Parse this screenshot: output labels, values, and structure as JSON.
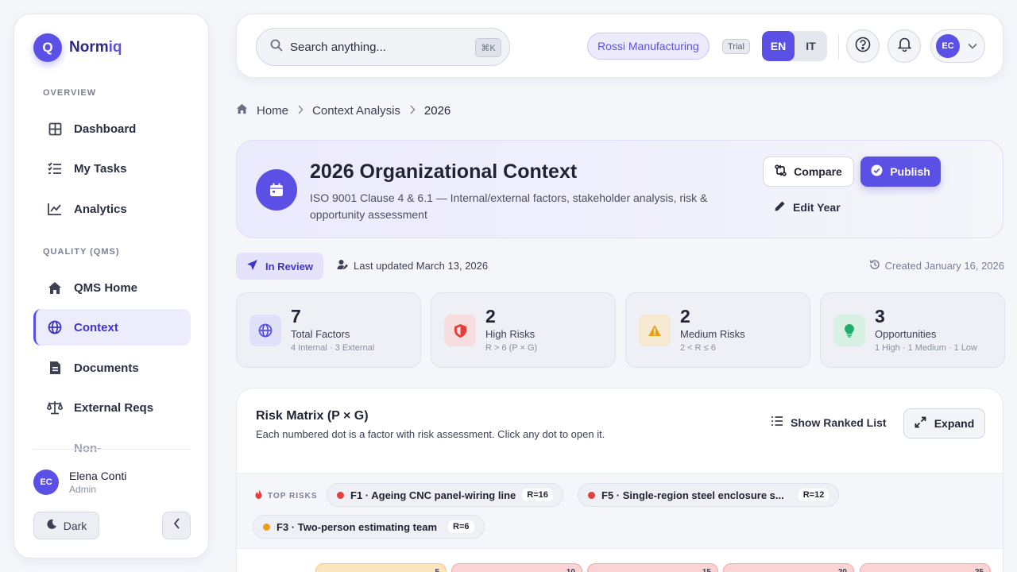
{
  "brand": {
    "name_prefix": "Norm",
    "name_suffix": "iq",
    "logo_letter": "Q"
  },
  "sidebar": {
    "sections": [
      {
        "label": "OVERVIEW"
      },
      {
        "label": "QUALITY (QMS)"
      }
    ],
    "items": [
      {
        "label": "Dashboard",
        "icon": "dashboard-grid-icon"
      },
      {
        "label": "My Tasks",
        "icon": "task-list-icon"
      },
      {
        "label": "Analytics",
        "icon": "line-chart-icon"
      },
      {
        "label": "QMS Home",
        "icon": "home-icon"
      },
      {
        "label": "Context",
        "icon": "globe-icon",
        "active": true
      },
      {
        "label": "Documents",
        "icon": "document-icon"
      },
      {
        "label": "External Reqs",
        "icon": "scale-icon"
      },
      {
        "label": "Non-",
        "icon": "none"
      }
    ],
    "user": {
      "initials": "EC",
      "name": "Elena Conti",
      "role": "Admin"
    },
    "theme_toggle": "Dark"
  },
  "topbar": {
    "search_placeholder": "Search anything...",
    "shortcut": "⌘K",
    "org": "Rossi Manufacturing",
    "plan": "Trial",
    "languages": [
      "EN",
      "IT"
    ],
    "active_language": "EN",
    "user_initials": "EC"
  },
  "breadcrumb": [
    "Home",
    "Context Analysis",
    "2026"
  ],
  "header": {
    "title": "2026 Organizational Context",
    "subtitle": "ISO 9001 Clause 4 & 6.1 — Internal/external factors, stakeholder analysis, risk & opportunity assessment",
    "compare": "Compare",
    "publish": "Publish",
    "edit": "Edit Year"
  },
  "status": {
    "state": "In Review",
    "updated": "Last updated March 13, 2026",
    "created": "Created January 16, 2026"
  },
  "stats": [
    {
      "value": "7",
      "label": "Total Factors",
      "sub": "4 Internal · 3 External",
      "color": "#5b50e6"
    },
    {
      "value": "2",
      "label": "High Risks",
      "sub": "R > 6 (P × G)",
      "color": "#e53e3e"
    },
    {
      "value": "2",
      "label": "Medium Risks",
      "sub": "2 < R ≤ 6",
      "color": "#e6a01a"
    },
    {
      "value": "3",
      "label": "Opportunities",
      "sub": "1 High · 1 Medium · 1 Low",
      "color": "#1fae6b"
    }
  ],
  "matrix": {
    "title": "Risk Matrix (P × G)",
    "subtitle": "Each numbered dot is a factor with risk assessment. Click any dot to open it.",
    "ranked_label": "Show Ranked List",
    "expand_label": "Expand",
    "top_risks_label": "TOP RISKS",
    "top_risks": [
      {
        "label": "F1 · Ageing CNC panel-wiring line",
        "score": "R=16",
        "color": "#e53e3e"
      },
      {
        "label": "F5 · Single-region steel enclosure s...",
        "score": "R=12",
        "color": "#e53e3e"
      },
      {
        "label": "F3 · Two-person estimating team",
        "score": "R=6",
        "color": "#e6a01a"
      }
    ],
    "cells": [
      "5",
      "10",
      "15",
      "20",
      "25"
    ]
  }
}
